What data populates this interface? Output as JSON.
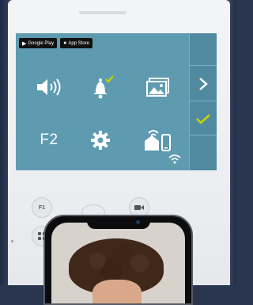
{
  "store_badges": [
    {
      "label": "Google Play",
      "icon": "play-icon"
    },
    {
      "label": "App Store",
      "icon": "apple-icon"
    }
  ],
  "screen_tiles": [
    {
      "name": "volume",
      "icon": "speaker-volume-icon"
    },
    {
      "name": "bell",
      "icon": "bell-check-icon"
    },
    {
      "name": "gallery",
      "icon": "image-gallery-icon"
    },
    {
      "name": "f2",
      "label": "F2"
    },
    {
      "name": "settings",
      "icon": "gear-icon"
    },
    {
      "name": "smart-home",
      "icon": "home-wifi-phone-icon"
    }
  ],
  "side_bar": {
    "next_icon": "chevron-right-icon",
    "confirm_icon": "checkmark-icon",
    "accent_color": "#c8d400"
  },
  "hardware_buttons": {
    "f1_label": "F1",
    "camera_icon": "video-camera-icon",
    "menu_icon": "grid-menu-icon"
  },
  "colors": {
    "screen_bg": "#5e9bb0",
    "side_bar_bg": "#4f8aa0",
    "panel_bg": "#eceef1",
    "icon_color": "#ffffff",
    "check_color": "#c8d400"
  }
}
